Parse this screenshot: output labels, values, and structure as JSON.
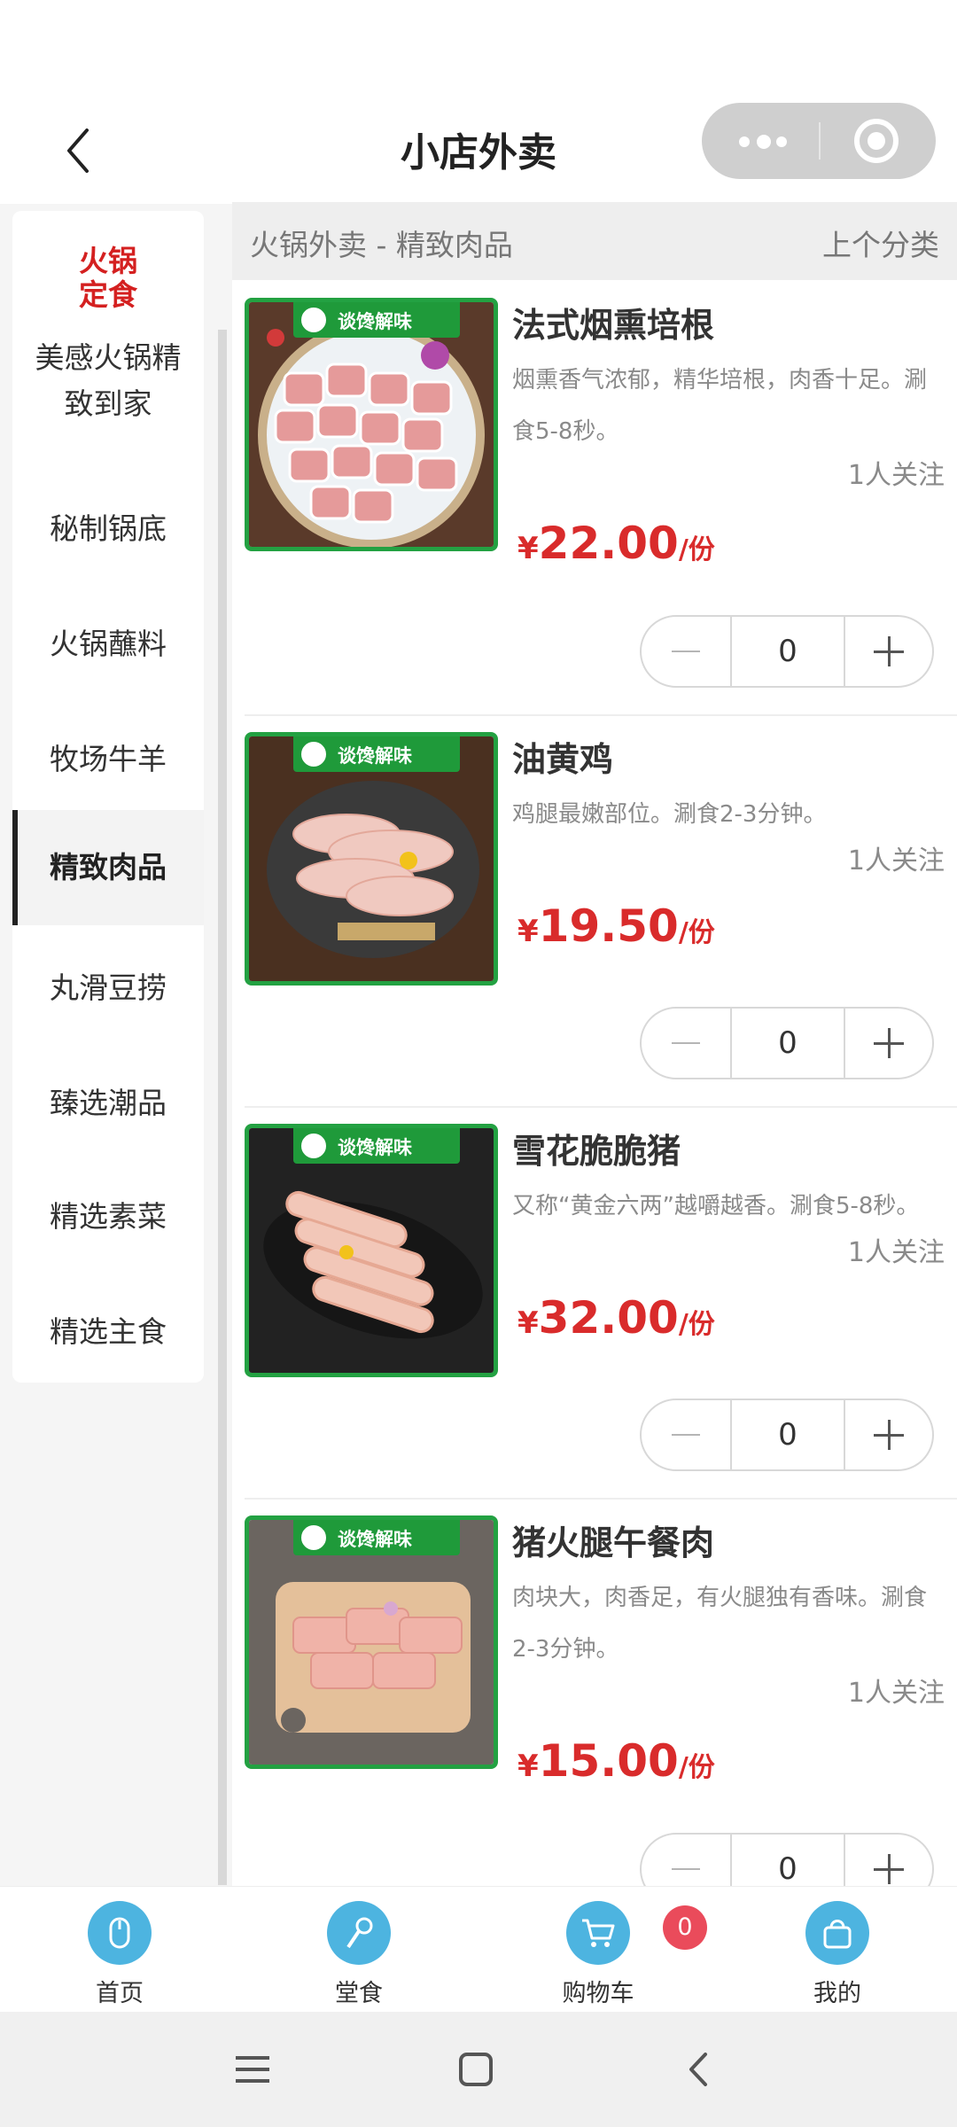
{
  "header": {
    "title": "小店外卖"
  },
  "sidebar": {
    "first": "火锅\n定食",
    "items": [
      {
        "label": "美感火锅精\n致到家"
      },
      {
        "label": "秘制锅底"
      },
      {
        "label": "火锅蘸料"
      },
      {
        "label": "牧场牛羊"
      },
      {
        "label": "精致肉品",
        "active": true
      },
      {
        "label": "丸滑豆捞"
      },
      {
        "label": "臻选潮品"
      },
      {
        "label": "精选素菜"
      },
      {
        "label": "精选主食"
      }
    ]
  },
  "section": {
    "title": "火锅外卖 - 精致肉品",
    "prev_label": "上个分类"
  },
  "badge_text": "谈馋解味",
  "products": [
    {
      "name": "法式烟熏培根",
      "desc": "烟熏香气浓郁，精华培根，肉香十足。涮食5-8秒。",
      "follow": "1人关注",
      "currency": "¥",
      "price": "22.00",
      "unit": "/份",
      "qty": "0"
    },
    {
      "name": "油黄鸡",
      "desc": "鸡腿最嫩部位。涮食2-3分钟。",
      "follow": "1人关注",
      "currency": "¥",
      "price": "19.50",
      "unit": "/份",
      "qty": "0"
    },
    {
      "name": "雪花脆脆猪",
      "desc": "又称“黄金六两”越嚼越香。涮食5-8秒。",
      "follow": "1人关注",
      "currency": "¥",
      "price": "32.00",
      "unit": "/份",
      "qty": "0"
    },
    {
      "name": "猪火腿午餐肉",
      "desc": "肉块大，肉香足，有火腿独有香味。涮食2-3分钟。",
      "follow": "1人关注",
      "currency": "¥",
      "price": "15.00",
      "unit": "/份",
      "qty": "0"
    }
  ],
  "tabbar": {
    "items": [
      {
        "label": "首页",
        "icon": "mouse-icon"
      },
      {
        "label": "堂食",
        "icon": "key-icon"
      },
      {
        "label": "购物车",
        "icon": "cart-icon"
      },
      {
        "label": "我的",
        "icon": "bag-icon"
      }
    ],
    "cart_count": "0"
  },
  "colors": {
    "accent_red": "#d92b2b",
    "badge_green": "#1f9a3a",
    "tab_icon_bg": "#4db4e0"
  }
}
